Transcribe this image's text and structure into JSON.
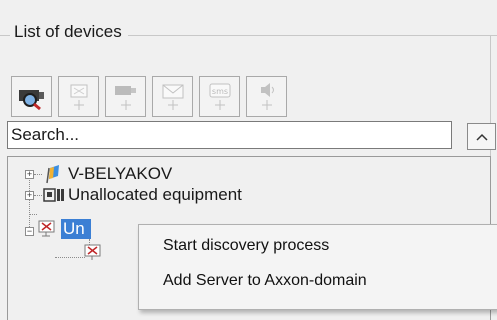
{
  "panel": {
    "title": "List of devices"
  },
  "toolbar": {
    "buttons": [
      {
        "icon": "search-camera-icon",
        "enabled": true
      },
      {
        "icon": "add-computer-icon",
        "enabled": false
      },
      {
        "icon": "add-camera-icon",
        "enabled": false
      },
      {
        "icon": "add-email-icon",
        "enabled": false
      },
      {
        "icon": "add-sms-icon",
        "enabled": false,
        "glyph_text": "sms"
      },
      {
        "icon": "add-speaker-icon",
        "enabled": false
      }
    ]
  },
  "search": {
    "placeholder": "Search..."
  },
  "tree": {
    "nodes": [
      {
        "label": "V-BELYAKOV",
        "icon": "server-flag-icon",
        "expander": "+"
      },
      {
        "label": "Unallocated equipment",
        "icon": "equipment-icon",
        "expander": "+"
      },
      {
        "label": "Un",
        "icon": "offline-server-icon",
        "expander": "−",
        "selected": true
      }
    ]
  },
  "context_menu": {
    "items": [
      {
        "label": "Start discovery process"
      },
      {
        "label": "Add Server to Axxon-domain"
      }
    ]
  },
  "colors": {
    "selection": "#3b7fd4",
    "accent_red": "#c0282a"
  }
}
